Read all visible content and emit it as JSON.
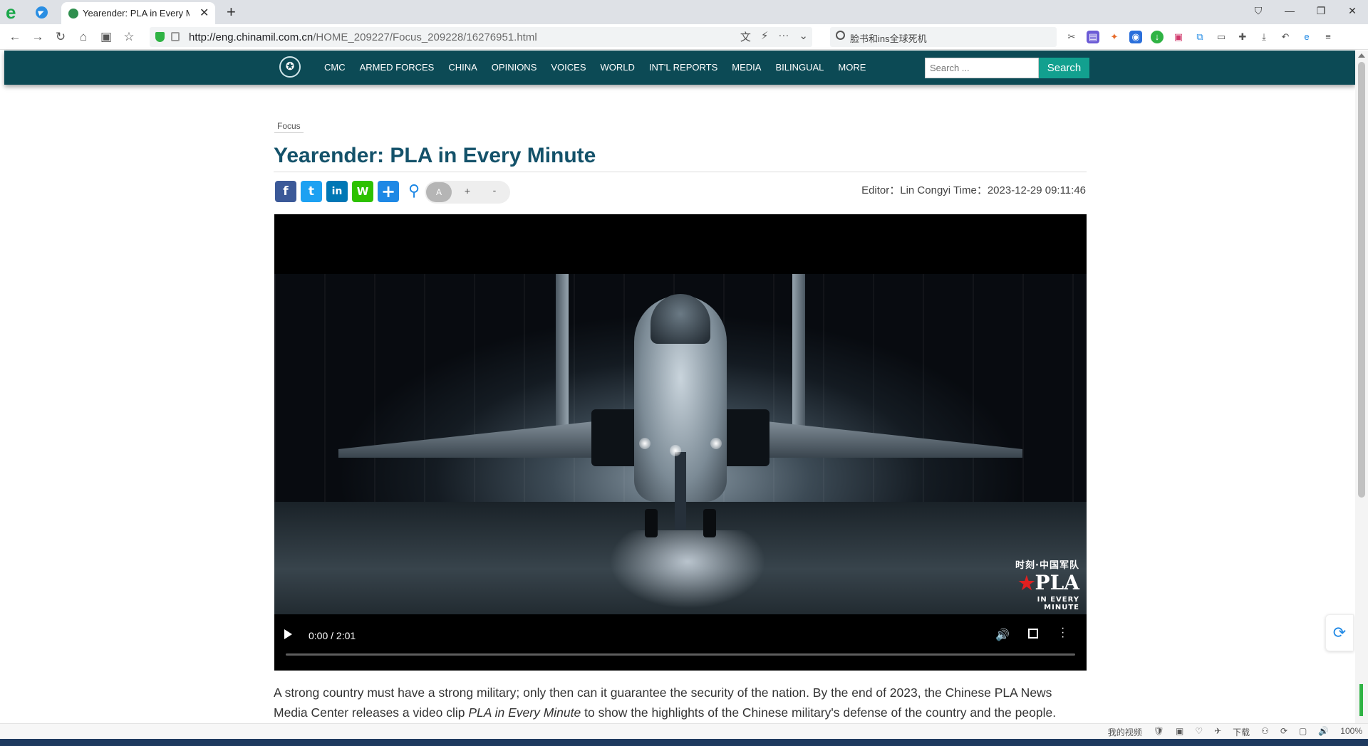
{
  "browser": {
    "tab_title": "Yearender: PLA in Every Mi",
    "tab_close": "✕",
    "new_tab": "+",
    "url_host": "http://eng.chinamil.com.cn",
    "url_path": "/HOME_209227/Focus_209228/16276951.html",
    "search_placeholder": "脸书和ins全球死机",
    "window_controls": [
      "⛉",
      "—",
      "❐",
      "✕"
    ]
  },
  "nav": {
    "menu": [
      "CMC",
      "ARMED FORCES",
      "CHINA",
      "OPINIONS",
      "VOICES",
      "WORLD",
      "INT'L REPORTS",
      "MEDIA",
      "BILINGUAL",
      "MORE"
    ],
    "search_placeholder": "Search ...",
    "search_button": "Search"
  },
  "article": {
    "breadcrumb": "Focus",
    "title": "Yearender: PLA in Every Minute",
    "editor_label": "Editor：",
    "editor": "Lin Congyi",
    "time_label": "Time：",
    "time": "2023-12-29 09:11:46",
    "font_controls": {
      "reset": "A",
      "increase": "+",
      "decrease": "-"
    },
    "share": [
      {
        "name": "facebook-share-icon",
        "glyph": "f"
      },
      {
        "name": "twitter-share-icon",
        "glyph": "t"
      },
      {
        "name": "linkedin-share-icon",
        "glyph": "in"
      },
      {
        "name": "wechat-share-icon",
        "glyph": "W"
      },
      {
        "name": "more-share-icon",
        "glyph": "+"
      },
      {
        "name": "zoom-icon",
        "glyph": "⚲"
      }
    ],
    "body_part1": "A strong country must have a strong military; only then can it guarantee the security of the nation. By the end of 2023, the Chinese PLA News Media Center releases a video clip ",
    "body_italic": "PLA in Every Minute",
    "body_part2": " to show the highlights of the Chinese military's defense of the country and the people."
  },
  "video": {
    "time_display": "0:00 / 2:01",
    "progress": 0,
    "watermark_cn": "时刻·中国军队",
    "watermark_main": "PLA",
    "watermark_star": "★",
    "watermark_sub": "IN EVERY MINUTE"
  },
  "statusbar": {
    "items": [
      "我的视频",
      "🛡",
      "▣",
      "♡",
      "✈",
      "下载",
      "⚇",
      "⟳",
      "▢",
      "🔊",
      "100%"
    ]
  }
}
